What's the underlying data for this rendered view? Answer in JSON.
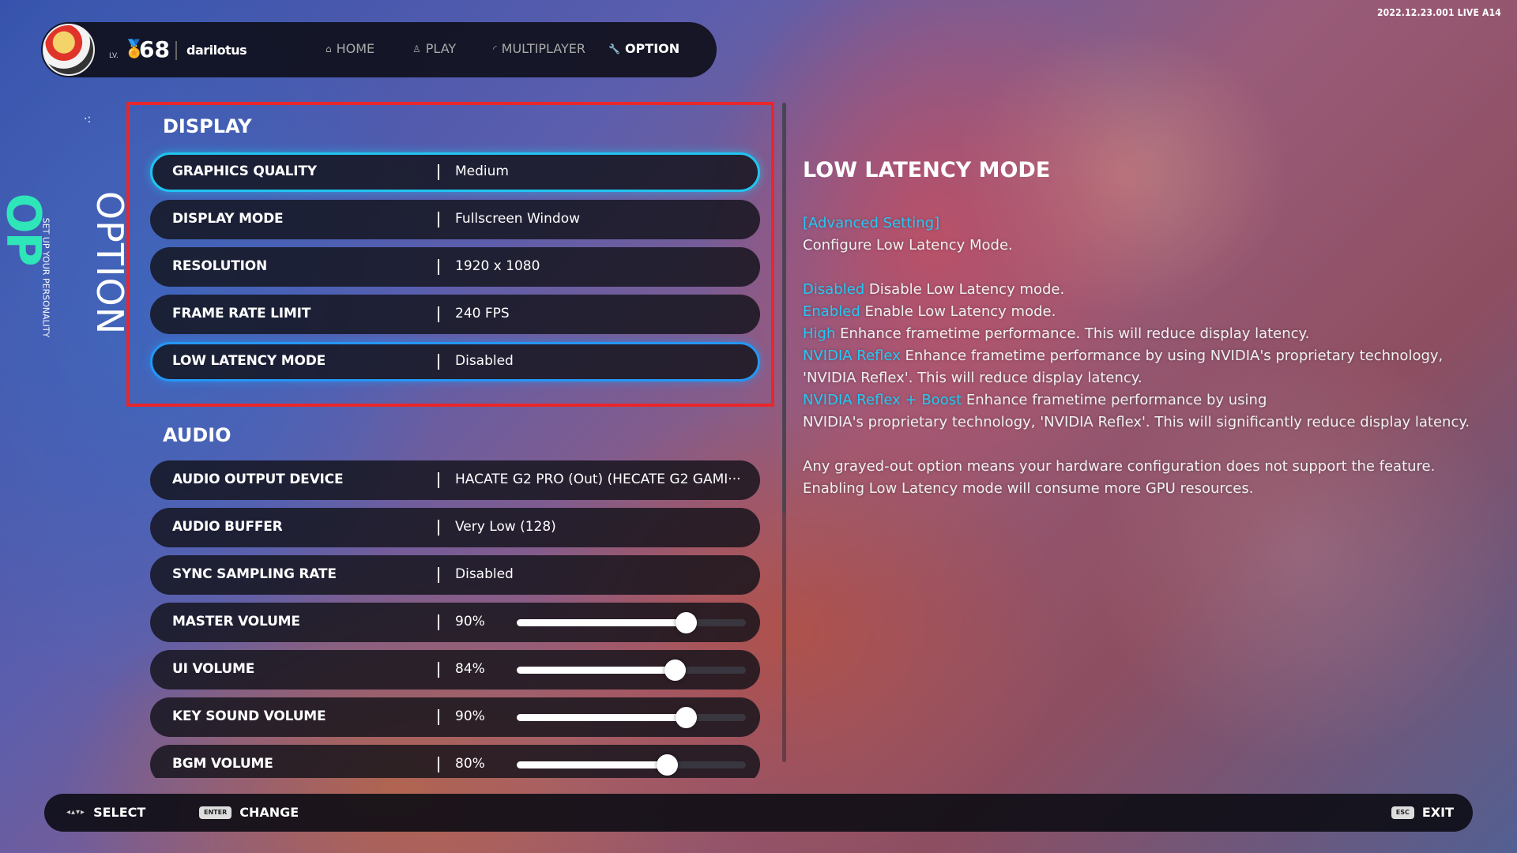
{
  "version": "2022.12.23.001 LIVE A14",
  "profile": {
    "level_prefix": "LV.",
    "level": "68",
    "username": "darilotus"
  },
  "nav": {
    "home": "HOME",
    "play": "PLAY",
    "multiplayer": "MULTIPLAYER",
    "option": "OPTION"
  },
  "side": {
    "op": "OP",
    "word": "OPTION",
    "subtitle": "SET UP YOUR PERSONALITY"
  },
  "display": {
    "title": "DISPLAY",
    "rows": [
      {
        "label": "GRAPHICS QUALITY",
        "value": "Medium"
      },
      {
        "label": "DISPLAY MODE",
        "value": "Fullscreen Window"
      },
      {
        "label": "RESOLUTION",
        "value": "1920 x 1080"
      },
      {
        "label": "FRAME RATE LIMIT",
        "value": "240 FPS"
      },
      {
        "label": "LOW LATENCY MODE",
        "value": "Disabled"
      }
    ]
  },
  "audio": {
    "title": "AUDIO",
    "rows": [
      {
        "label": "AUDIO OUTPUT DEVICE",
        "value": "HACATE G2 PRO (Out) (HECATE G2 GAMI···"
      },
      {
        "label": "AUDIO BUFFER",
        "value": "Very Low (128)"
      },
      {
        "label": "SYNC SAMPLING RATE",
        "value": "Disabled"
      },
      {
        "label": "MASTER VOLUME",
        "value": "90%",
        "level": 0.9
      },
      {
        "label": "UI VOLUME",
        "value": "84%",
        "level": 0.84
      },
      {
        "label": "KEY SOUND VOLUME",
        "value": "90%",
        "level": 0.9
      },
      {
        "label": "BGM VOLUME",
        "value": "80%",
        "level": 0.8
      }
    ]
  },
  "description": {
    "title": "LOW LATENCY MODE",
    "advanced": "[Advanced Setting]",
    "intro": "Configure Low Latency Mode.",
    "options": [
      {
        "name": "Disabled",
        "text": " Disable Low Latency mode."
      },
      {
        "name": "Enabled",
        "text": " Enable Low Latency mode."
      },
      {
        "name": "High",
        "text": " Enhance frametime performance. This will reduce display latency."
      },
      {
        "name": "NVIDIA Reflex",
        "text": " Enhance frametime performance by using NVIDIA's proprietary technology, 'NVIDIA Reflex'. This will reduce display latency."
      },
      {
        "name": "NVIDIA Reflex + Boost",
        "text": " Enhance frametime performance by using"
      }
    ],
    "boost_line2": "NVIDIA's proprietary technology, 'NVIDIA Reflex'. This will significantly reduce display latency.",
    "note1": "Any grayed-out option means your hardware configuration does not support the feature.",
    "note2": "Enabling Low Latency mode will consume more GPU resources."
  },
  "footer": {
    "select": "SELECT",
    "change": "CHANGE",
    "exit": "EXIT",
    "enter_key": "ENTER",
    "esc_key": "ESC"
  },
  "colors": {
    "accent_cyan": "#23c9f5",
    "focus_frame": "#e8262b",
    "op_green": "#2ee6b8"
  }
}
